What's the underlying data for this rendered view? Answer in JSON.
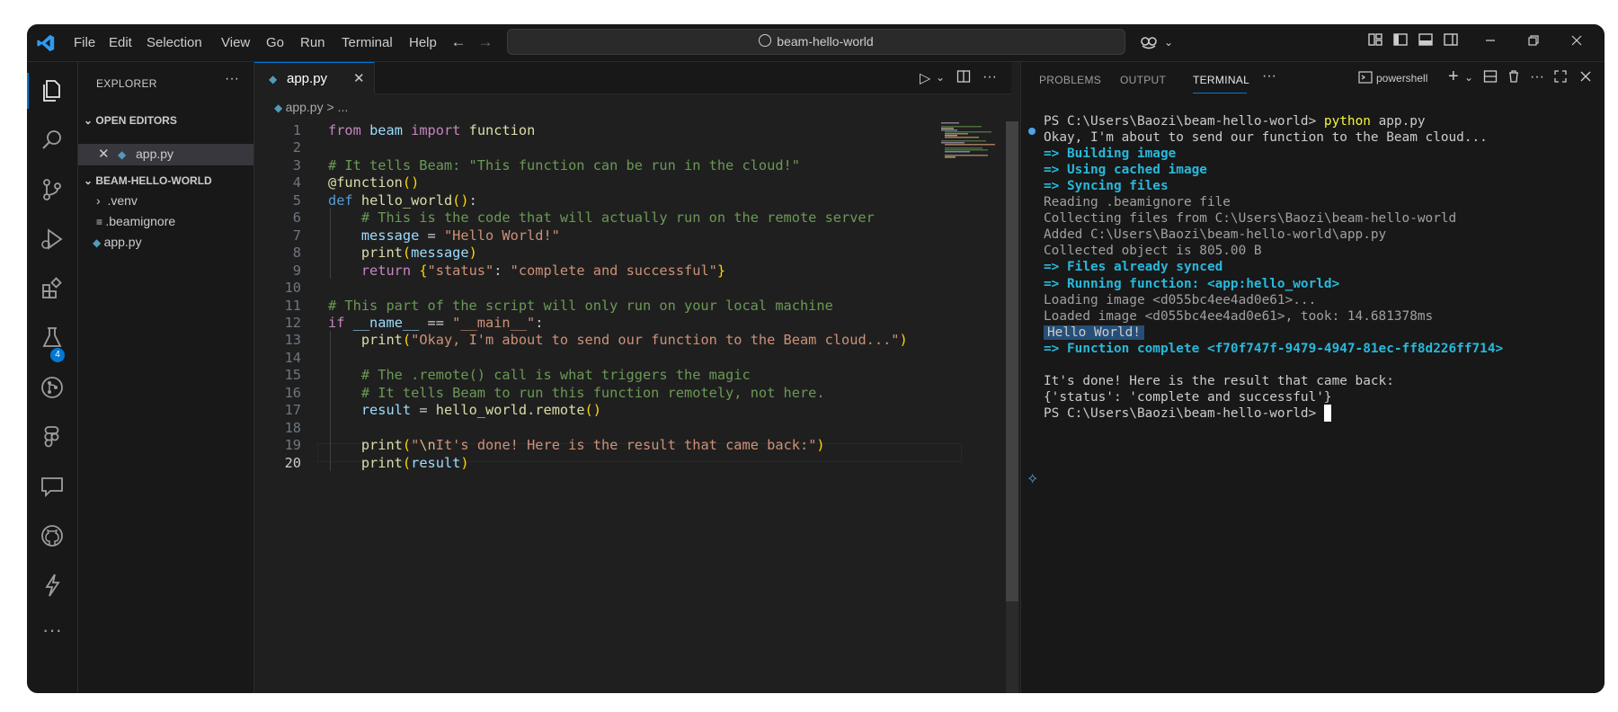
{
  "titlebar": {
    "menu": [
      "File",
      "Edit",
      "Selection",
      "View",
      "Go",
      "Run",
      "Terminal",
      "Help"
    ],
    "search_text": "beam-hello-world"
  },
  "activity": {
    "icons": [
      "explorer-icon",
      "search-icon",
      "source-control-icon",
      "run-debug-icon",
      "extensions-icon",
      "testing-icon",
      "git-graph-icon",
      "figma-icon",
      "chat-icon",
      "github-icon",
      "lightning-icon",
      "more-icon"
    ],
    "extensions_badge": "4"
  },
  "sidebar": {
    "title": "EXPLORER",
    "open_editors_label": "OPEN EDITORS",
    "open_editor_file": "app.py",
    "project_label": "BEAM-HELLO-WORLD",
    "items": [
      ".venv",
      ".beamignore",
      "app.py"
    ]
  },
  "editor": {
    "tab_label": "app.py",
    "breadcrumb": "app.py > ...",
    "current_line": 20
  },
  "code_lines": [
    "from beam import function",
    "",
    "# It tells Beam: \"This function can be run in the cloud!\"",
    "@function()",
    "def hello_world():",
    "    # This is the code that will actually run on the remote server",
    "    message = \"Hello World!\"",
    "    print(message)",
    "    return {\"status\": \"complete and successful\"}",
    "",
    "# This part of the script will only run on your local machine",
    "if __name__ == \"__main__\":",
    "    print(\"Okay, I'm about to send our function to the Beam cloud...\")",
    "",
    "    # The .remote() call is what triggers the magic",
    "    # It tells Beam to run this function remotely, not here.",
    "    result = hello_world.remote()",
    "",
    "    print(\"\\nIt's done! Here is the result that came back:\")",
    "    print(result)"
  ],
  "panel": {
    "tabs": [
      "PROBLEMS",
      "OUTPUT",
      "TERMINAL"
    ],
    "active_tab": "TERMINAL",
    "shell": "powershell"
  },
  "terminal": {
    "prompt_path": "PS C:\\Users\\Baozi\\beam-hello-world>",
    "command_name": "python",
    "command_arg": "app.py",
    "lines": [
      {
        "text": "Okay, I'm about to send our function to the Beam cloud...",
        "style": "normal"
      },
      {
        "text": "=> Building image",
        "style": "cyan"
      },
      {
        "text": "=> Using cached image",
        "style": "cyan"
      },
      {
        "text": "=> Syncing files",
        "style": "cyan"
      },
      {
        "text": "Reading .beamignore file",
        "style": "gray"
      },
      {
        "text": "Collecting files from C:\\Users\\Baozi\\beam-hello-world",
        "style": "gray"
      },
      {
        "text": "Added C:\\Users\\Baozi\\beam-hello-world\\app.py",
        "style": "gray"
      },
      {
        "text": "Collected object is 805.00 B",
        "style": "gray"
      },
      {
        "text": "=> Files already synced",
        "style": "cyan"
      },
      {
        "text": "=> Running function: <app:hello_world>",
        "style": "cyan"
      },
      {
        "text": "Loading image <d055bc4ee4ad0e61>...",
        "style": "gray"
      },
      {
        "text": "Loaded image <d055bc4ee4ad0e61>, took: 14.681378ms",
        "style": "gray"
      },
      {
        "text": "Hello World!",
        "style": "highlight"
      },
      {
        "text": "=> Function complete <f70f747f-9479-4947-81ec-ff8d226ff714>",
        "style": "cyan"
      },
      {
        "text": "",
        "style": "normal"
      },
      {
        "text": "It's done! Here is the result that came back:",
        "style": "normal"
      },
      {
        "text": "{'status': 'complete and successful'}",
        "style": "normal"
      }
    ],
    "final_prompt": "PS C:\\Users\\Baozi\\beam-hello-world>"
  }
}
